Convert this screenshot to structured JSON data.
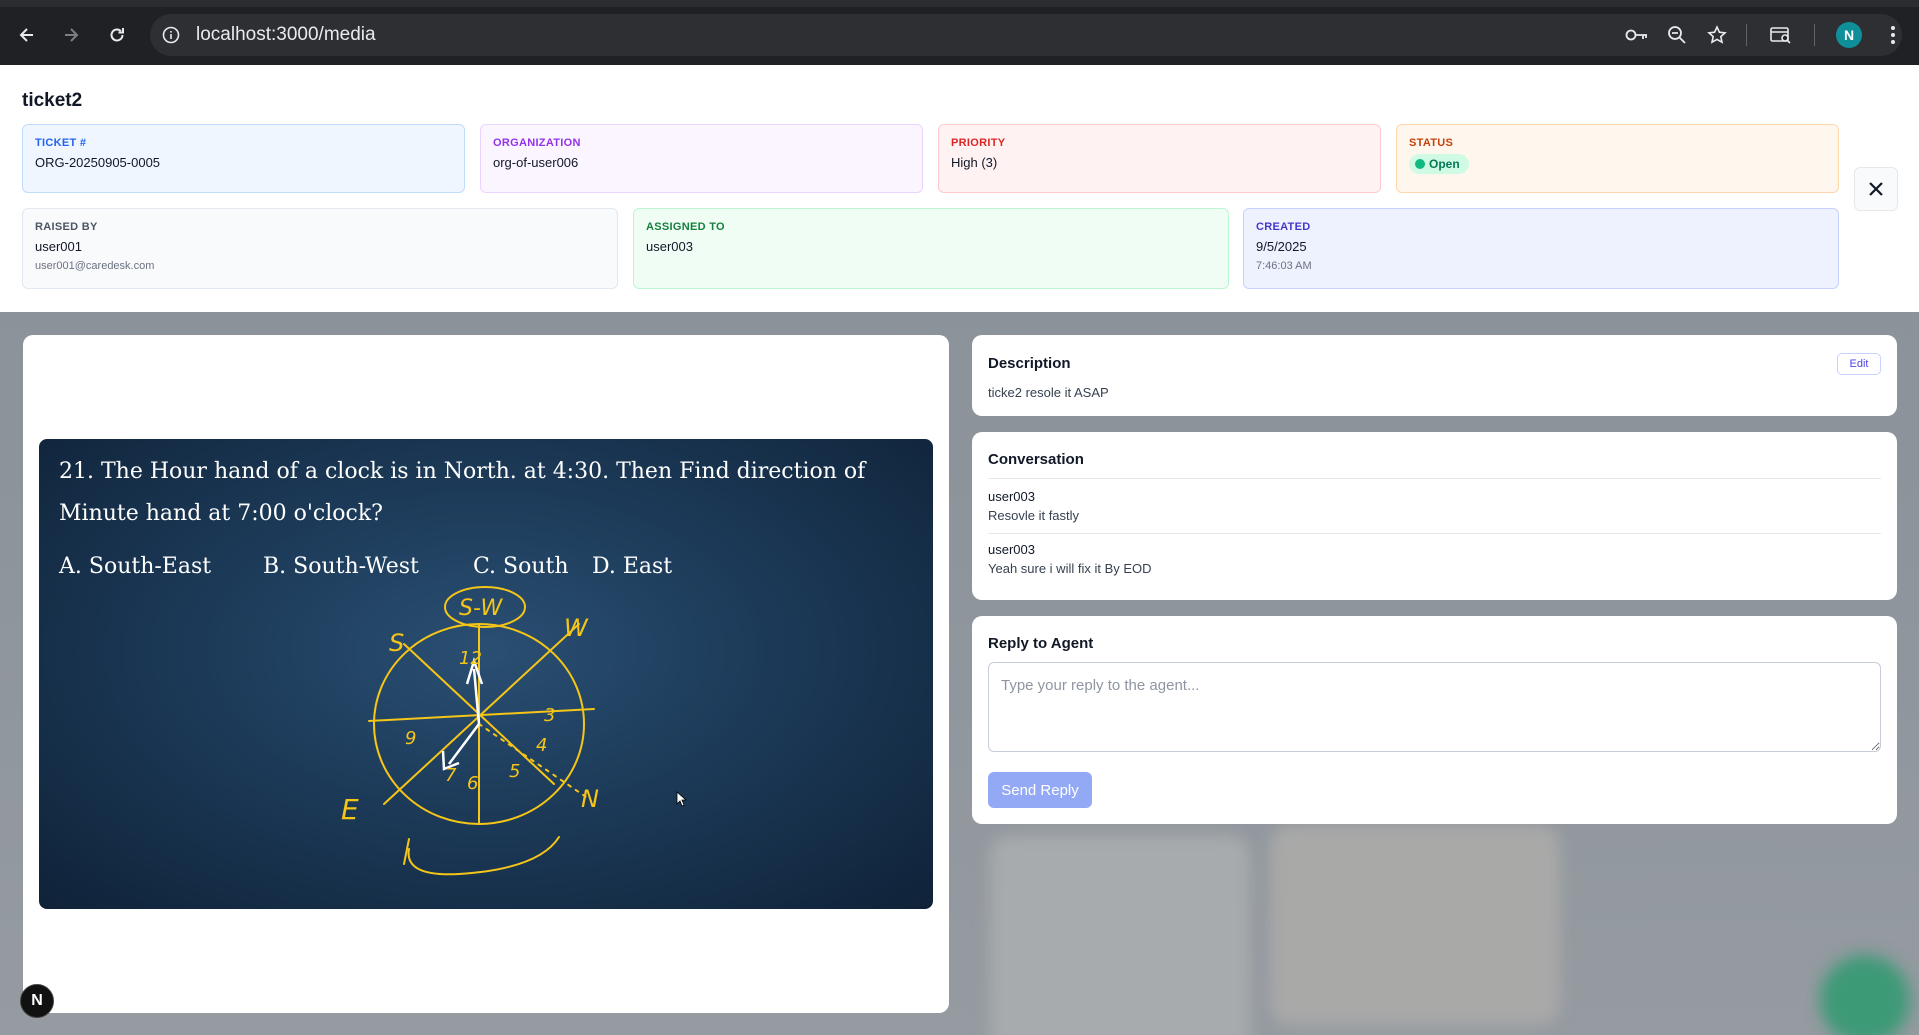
{
  "browser": {
    "url": "localhost:3000/media",
    "profile_initial": "N"
  },
  "ticket": {
    "title": "ticket2",
    "ticket_no_label": "TICKET #",
    "ticket_no": "ORG-20250905-0005",
    "organization_label": "ORGANIZATION",
    "organization": "org-of-user006",
    "priority_label": "PRIORITY",
    "priority": "High (3)",
    "status_label": "STATUS",
    "status": "Open",
    "raised_by_label": "RAISED BY",
    "raised_by": "user001",
    "raised_by_email": "user001@caredesk.com",
    "assigned_to_label": "ASSIGNED TO",
    "assigned_to": "user003",
    "created_label": "CREATED",
    "created_date": "9/5/2025",
    "created_time": "7:46:03 AM"
  },
  "media": {
    "question_line1": "21. The Hour hand of a clock is in North. at 4:30. Then Find direction of",
    "question_line2": "Minute hand at 7:00 o'clock?",
    "option_a": "A. South-East",
    "option_b": "B. South-West",
    "option_c": "C. South",
    "option_d": "D. East",
    "sketch_labels": {
      "top": "S-W",
      "s": "S",
      "w": "W",
      "e": "E",
      "n": "N",
      "twelve": "12",
      "three": "3",
      "six": "6",
      "nine": "9",
      "four": "4",
      "five": "5",
      "seven": "7"
    }
  },
  "description": {
    "title": "Description",
    "edit_label": "Edit",
    "text": "ticke2 resole it ASAP"
  },
  "conversation": {
    "title": "Conversation",
    "messages": [
      {
        "author": "user003",
        "text": "Resovle it fastly"
      },
      {
        "author": "user003",
        "text": "Yeah sure i will fix it By EOD"
      }
    ]
  },
  "reply": {
    "title": "Reply to Agent",
    "placeholder": "Type your reply to the agent...",
    "send_label": "Send Reply"
  },
  "floating": {
    "badge": "N"
  },
  "colors": {
    "ticket_card": "#eff6ff",
    "org_card": "#faf5ff",
    "priority_card": "#fef2f2",
    "status_card": "#fff7ed",
    "raised_card": "#f8fafc",
    "assigned_card": "#f0fdf4",
    "created_card": "#eef2ff",
    "sketch": "#f5c518"
  }
}
